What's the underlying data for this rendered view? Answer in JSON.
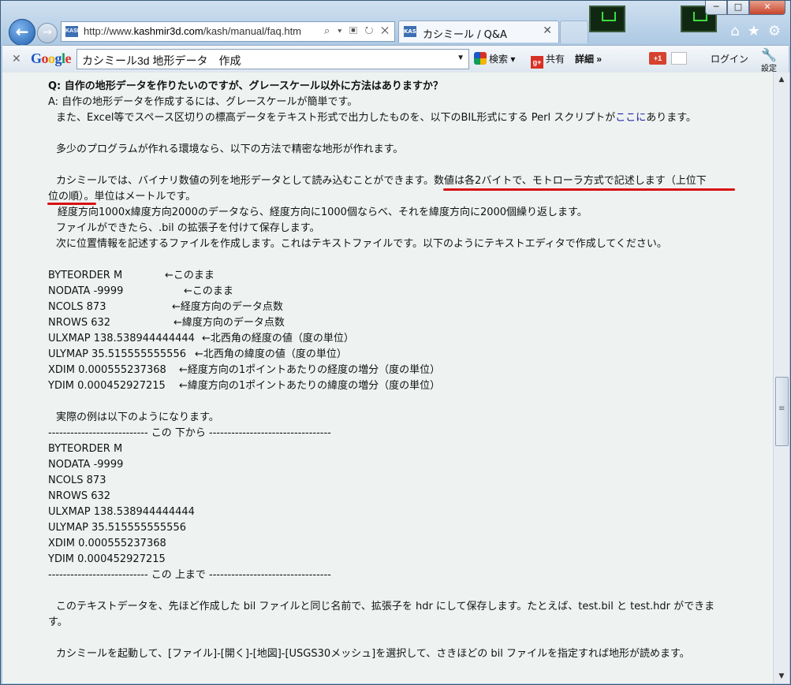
{
  "window": {
    "caption_buttons": [
      "─",
      "□",
      "✕"
    ]
  },
  "nav": {
    "back_icon": "←",
    "forward_icon": "→",
    "url_prefix": "http://www.",
    "url_host": "kashmir3d.com",
    "url_path": "/kash/manual/faq.htm",
    "address_icons": "⌕ ▾ ▣ ↻ ✕",
    "tab_title": "カシミール / Q&A",
    "tab_close": "✕",
    "favicon_text": "KASH",
    "right_icons": [
      "⌂",
      "★",
      "⚙"
    ]
  },
  "google_toolbar": {
    "close": "✕",
    "logo": [
      "G",
      "o",
      "o",
      "g",
      "l",
      "e"
    ],
    "search_value": "カシミール3d 地形データ　作成",
    "search_label": "検索",
    "share_label": "共有",
    "more_label": "詳細 »",
    "plus_one_label": "+1",
    "login_label": "ログイン",
    "settings_label": "設定"
  },
  "article": {
    "question": "Q: 自作の地形データを作りたいのですが、グレースケール以外に方法はありますか？",
    "answer_intro": "A: 自作の地形データを作成するには、グレースケールが簡単です。",
    "p1_before": "また、Excel等でスペース区切りの標高データをテキスト形式で出力したものを、以下のBIL形式にする Perl スクリプトが",
    "p1_link": "ここに",
    "p1_after": "あります。",
    "p2": "多少のプログラムが作れる環境なら、以下の方法で精密な地形が作れます。",
    "p3_line1": "カシミールでは、バイナリ数値の列を地形データとして読み込むことができます。数値は各2バイトで、モトローラ方式で記述します（上位下",
    "p3_line2": "位の順）。単位はメートルです。",
    "p4": "経度方向1000x緯度方向2000のデータなら、経度方向に1000個ならべ、それを緯度方向に2000個繰り返します。",
    "p5": "ファイルができたら、.bil の拡張子を付けて保存します。",
    "p6": "次に位置情報を記述するファイルを作成します。これはテキストファイルです。以下のようにテキストエディタで作成してください。",
    "header_rows": [
      {
        "key": "BYTEORDER M",
        "note": "←このまま"
      },
      {
        "key": "NODATA -9999",
        "note": "←このまま"
      },
      {
        "key": "NCOLS 873",
        "note": "←経度方向のデータ点数"
      },
      {
        "key": "NROWS 632",
        "note": "←緯度方向のデータ点数"
      },
      {
        "key": "ULXMAP 138.538944444444",
        "note": "←北西角の経度の値（度の単位）"
      },
      {
        "key": "ULYMAP 35.515555555556",
        "note": "←北西角の緯度の値（度の単位）"
      },
      {
        "key": "XDIM 0.000555237368",
        "note": "←経度方向の1ポイントあたりの経度の増分（度の単位）"
      },
      {
        "key": "YDIM 0.000452927215",
        "note": "←緯度方向の1ポイントあたりの緯度の増分（度の単位）"
      }
    ],
    "example_intro": "実際の例は以下のようになります。",
    "sep_start": "--------------------------- この 下から ---------------------------------",
    "example_rows": [
      "BYTEORDER M",
      "NODATA -9999",
      "NCOLS 873",
      "NROWS 632",
      "ULXMAP 138.538944444444",
      "ULYMAP 35.515555555556",
      "XDIM 0.000555237368",
      "YDIM 0.000452927215"
    ],
    "sep_end": "--------------------------- この 上まで ---------------------------------",
    "p7_line1": "このテキストデータを、先ほど作成した bil ファイルと同じ名前で、拡張子を hdr にして保存します。たとえば、test.bil と test.hdr ができま",
    "p7_line2": "す。",
    "p8": "カシミールを起動して、[ファイル]-[開く]-[地図]-[USGS30メッシュ]を選択して、さきほどの bil ファイルを指定すれば地形が読めます。"
  },
  "colors": {
    "link": "#1a1aa6",
    "annotation_red": "#d81010",
    "page_bg": "#eef3f1"
  }
}
